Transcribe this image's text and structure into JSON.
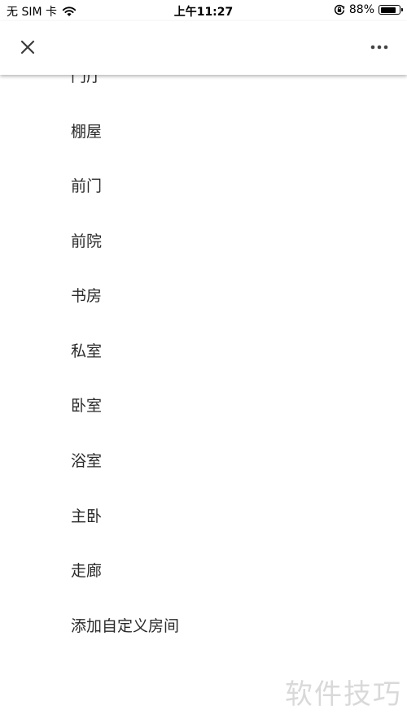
{
  "status_bar": {
    "carrier": "无 SIM 卡",
    "time": "上午11:27",
    "battery_percent": "88%",
    "battery_level": 0.88
  },
  "toolbar": {
    "close_icon": "close-icon",
    "more_icon": "more-horizontal-icon"
  },
  "rooms": [
    {
      "label": "门厅"
    },
    {
      "label": "棚屋"
    },
    {
      "label": "前门"
    },
    {
      "label": "前院"
    },
    {
      "label": "书房"
    },
    {
      "label": "私室"
    },
    {
      "label": "卧室"
    },
    {
      "label": "浴室"
    },
    {
      "label": "主卧"
    },
    {
      "label": "走廊"
    },
    {
      "label": "添加自定义房间"
    }
  ],
  "watermark": "软件技巧"
}
